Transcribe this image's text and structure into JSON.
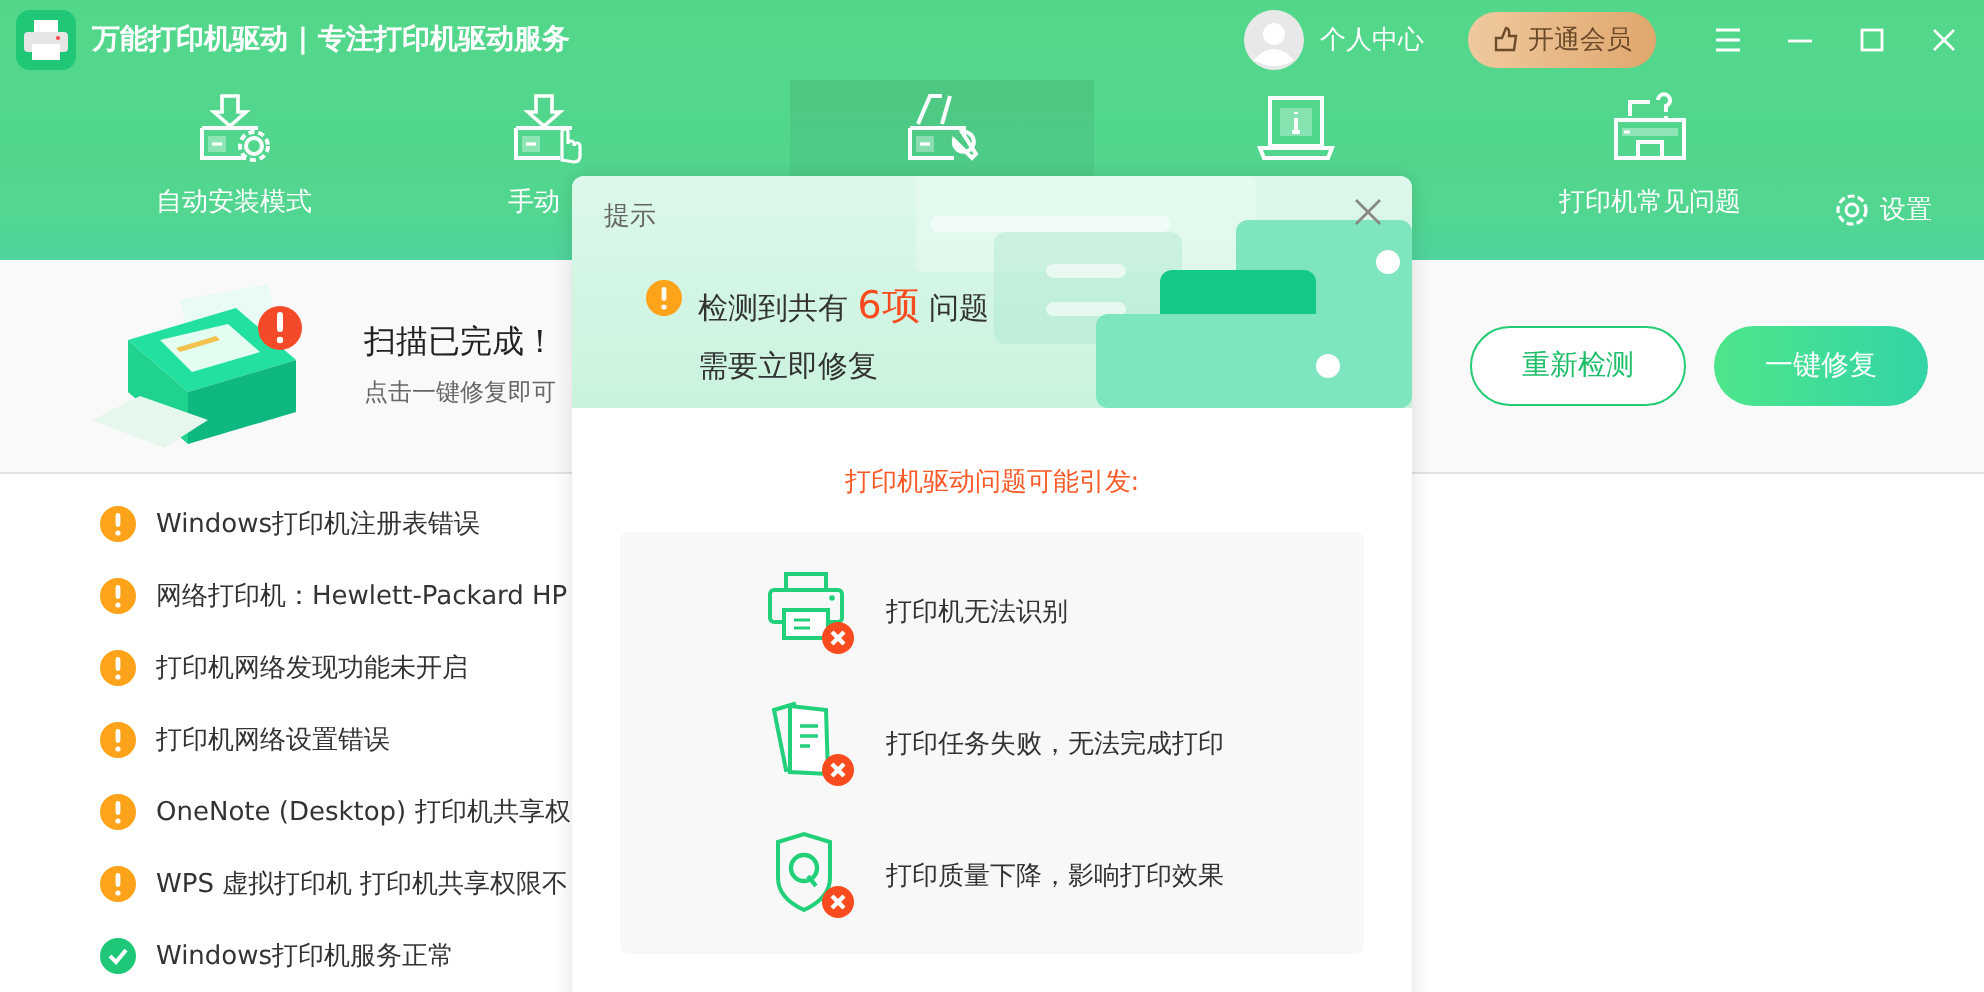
{
  "window": {
    "title": "万能打印机驱动 | 专注打印机驱动服务",
    "user_label": "个人中心",
    "vip_button": "开通会员"
  },
  "tabs": [
    {
      "label": "自动安装模式",
      "selected": false
    },
    {
      "label": "手动",
      "selected": false
    },
    {
      "selected": true
    },
    {
      "selected": false
    },
    {
      "label": "打印机常见问题",
      "selected": false
    }
  ],
  "settings": "设置",
  "scan_status": {
    "title": "扫描已完成！",
    "subtitle": "点击一键修复即可",
    "rescan_button": "重新检测",
    "fix_button": "一键修复"
  },
  "issues": [
    {
      "kind": "warning",
      "text": "Windows打印机注册表错误"
    },
    {
      "kind": "warning",
      "text": "网络打印机：Hewlett-Packard HP"
    },
    {
      "kind": "warning",
      "text": "打印机网络发现功能未开启"
    },
    {
      "kind": "warning",
      "text": "打印机网络设置错误"
    },
    {
      "kind": "warning",
      "text": "OneNote (Desktop) 打印机共享权"
    },
    {
      "kind": "warning",
      "text": "WPS 虚拟打印机 打印机共享权限不"
    },
    {
      "kind": "ok",
      "text": "Windows打印机服务正常"
    }
  ],
  "dialog": {
    "title": "提示",
    "message": "检测到共有 **6项** 问题",
    "message_line2": "需要立即修复",
    "consequences_title": "打印机驱动问题可能引发:",
    "consequences": [
      {
        "kind": "printer",
        "text": "打印机无法识别"
      },
      {
        "kind": "documents",
        "text": "打印任务失败，无法完成打印"
      },
      {
        "kind": "quality",
        "text": "打印质量下降，影响打印效果"
      }
    ]
  }
}
